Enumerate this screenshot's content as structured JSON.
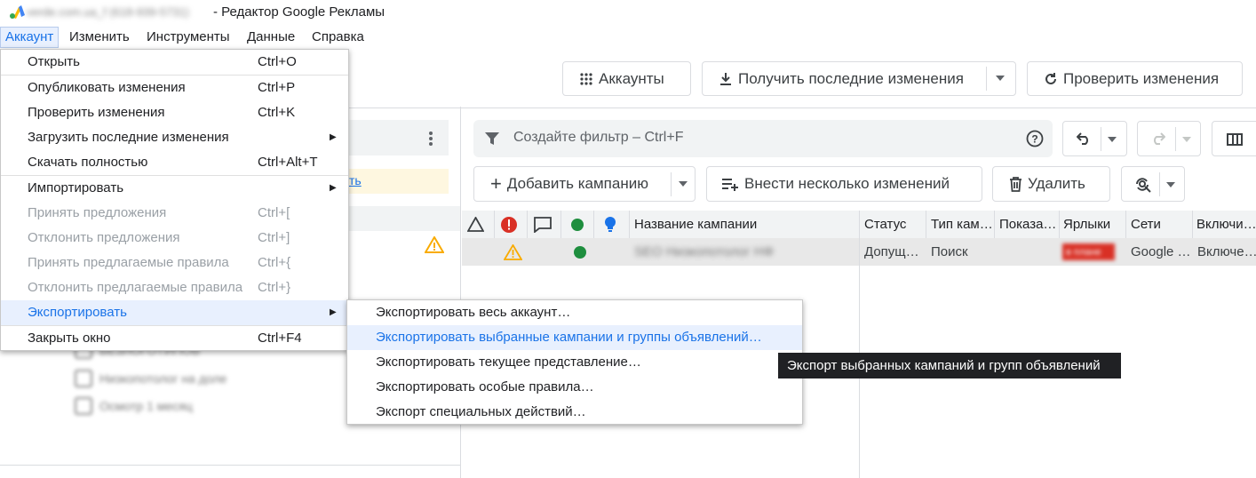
{
  "window": {
    "title_blurred": "verde.com.ua_f (618-939-5731)",
    "title": " - Редактор Google Рекламы"
  },
  "menubar": [
    "Аккаунт",
    "Изменить",
    "Инструменты",
    "Данные",
    "Справка"
  ],
  "toolbar": {
    "accounts": "Аккаунты",
    "get_changes": "Получить последние изменения",
    "check_changes": "Проверить изменения"
  },
  "filter": {
    "placeholder": "Создайте фильтр – Ctrl+F"
  },
  "actions": {
    "add_campaign": "Добавить кампанию",
    "multiple_changes": "Внести несколько изменений",
    "delete": "Удалить"
  },
  "left_panel": {
    "link_fragment": "ть",
    "blurred_items": [
      "БЕЗЛОГОТИПОВ",
      "Низкопотолог на доле",
      "Осмотр 1 месяц"
    ]
  },
  "table": {
    "headers": [
      "Название кампании",
      "Статус",
      "Тип кам…",
      "Показа…",
      "Ярлыки",
      "Сети",
      "Включи…"
    ],
    "row": {
      "campaign_blurred": "SEO Низкопотолог НФ",
      "status": "Допущ…",
      "type": "Поиск",
      "label_blurred": "в плане",
      "networks": "Google …",
      "enabled": "Включе…"
    }
  },
  "account_menu": {
    "items": [
      {
        "label": "Открыть",
        "shortcut": "Ctrl+O"
      },
      {
        "label": "Опубликовать изменения",
        "shortcut": "Ctrl+P"
      },
      {
        "label": "Проверить изменения",
        "shortcut": "Ctrl+K"
      },
      {
        "label": "Загрузить последние изменения",
        "shortcut": ""
      },
      {
        "label": "Скачать полностью",
        "shortcut": "Ctrl+Alt+T"
      },
      {
        "label": "Импортировать",
        "shortcut": ""
      },
      {
        "label": "Принять предложения",
        "shortcut": "Ctrl+["
      },
      {
        "label": "Отклонить предложения",
        "shortcut": "Ctrl+]"
      },
      {
        "label": "Принять предлагаемые правила",
        "shortcut": "Ctrl+{"
      },
      {
        "label": "Отклонить предлагаемые правила",
        "shortcut": "Ctrl+}"
      },
      {
        "label": "Экспортировать",
        "shortcut": ""
      },
      {
        "label": "Закрыть окно",
        "shortcut": "Ctrl+F4"
      }
    ]
  },
  "export_submenu": {
    "items": [
      "Экспортировать весь аккаунт…",
      "Экспортировать выбранные кампании и группы объявлений…",
      "Экспортировать текущее представление…",
      "Экспортировать особые правила…",
      "Экспорт специальных действий…"
    ]
  },
  "tooltip": "Экспорт выбранных кампаний и групп объявлений",
  "colors": {
    "accent": "#1a73e8",
    "selected_bg": "#e8f0fe",
    "warning": "#f9ab00",
    "error": "#d93025",
    "enabled_dot": "#1e8e3e"
  }
}
